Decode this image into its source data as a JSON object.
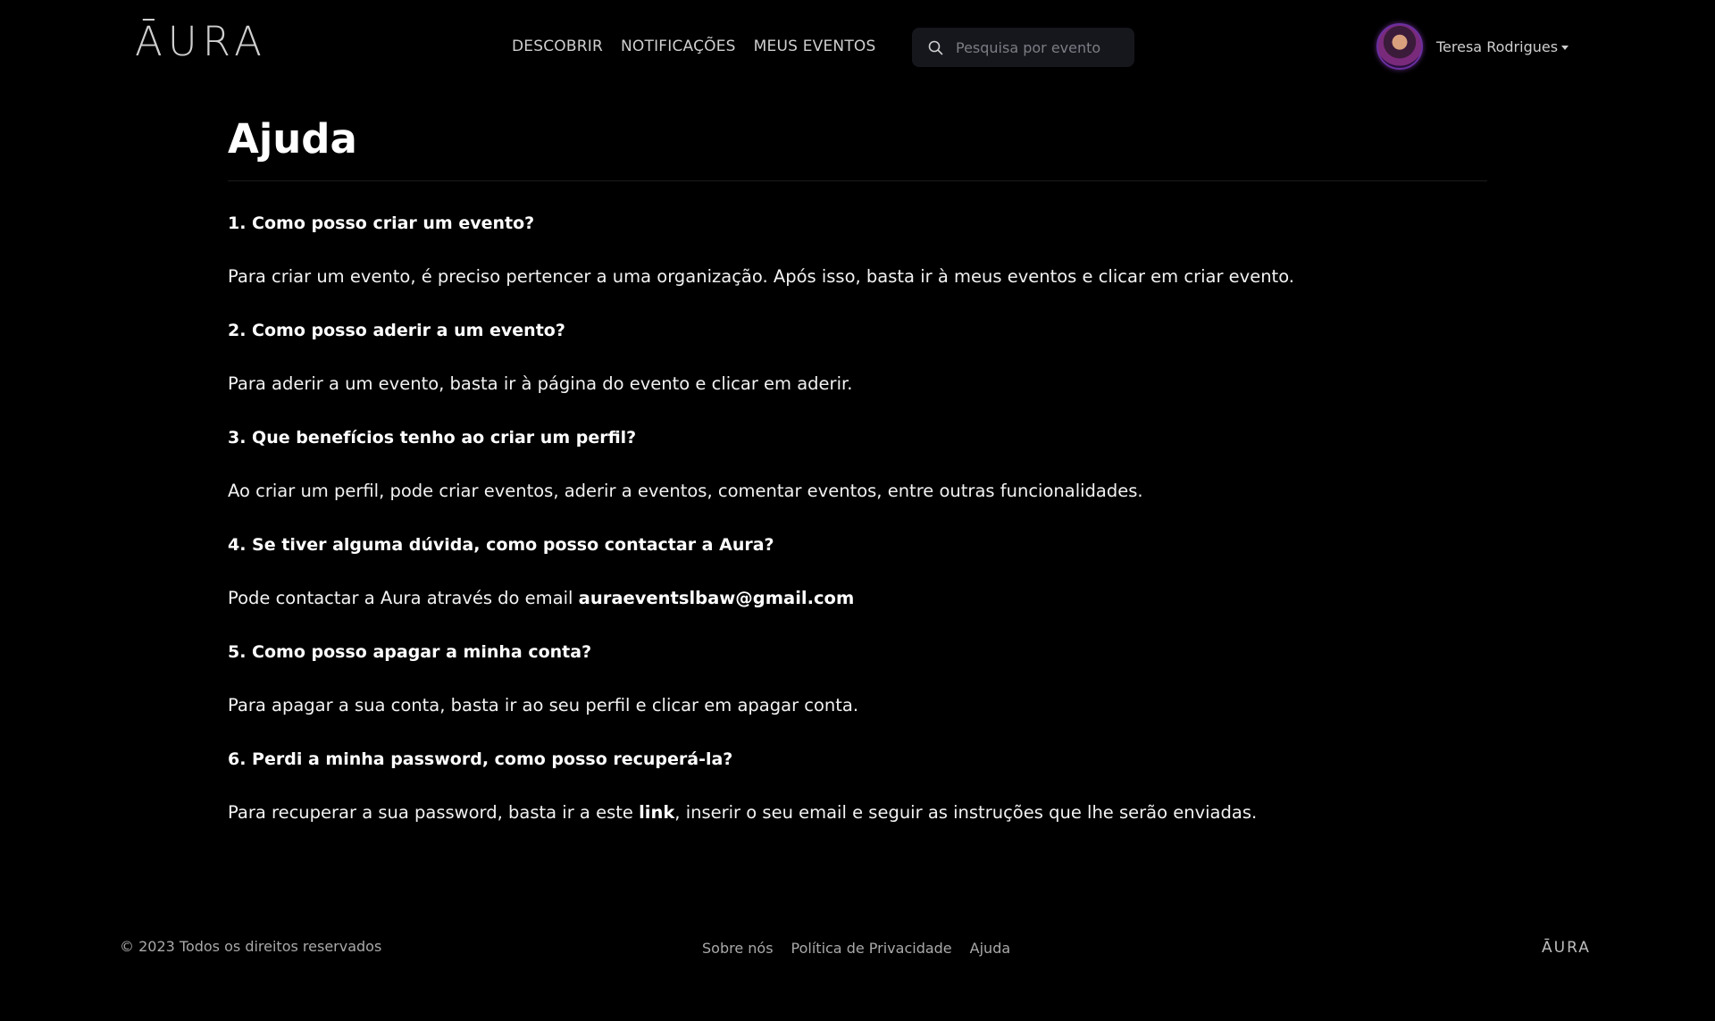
{
  "header": {
    "logo_text": "ĀURA",
    "nav": [
      {
        "label": "DESCOBRIR"
      },
      {
        "label": "NOTIFICAÇÕES"
      },
      {
        "label": "MEUS EVENTOS"
      }
    ],
    "search": {
      "placeholder": "Pesquisa por evento",
      "value": ""
    },
    "user": {
      "name": "Teresa Rodrigues"
    }
  },
  "page": {
    "title": "Ajuda"
  },
  "faq": [
    {
      "question": "1. Como posso criar um evento?",
      "answer": "Para criar um evento, é preciso pertencer a uma organização. Após isso, basta ir à meus eventos e clicar em criar evento."
    },
    {
      "question": "2. Como posso aderir a um evento?",
      "answer": "Para aderir a um evento, basta ir à página do evento e clicar em aderir."
    },
    {
      "question": "3. Que benefícios tenho ao criar um perfil?",
      "answer": "Ao criar um perfil, pode criar eventos, aderir a eventos, comentar eventos, entre outras funcionalidades."
    },
    {
      "question": "4. Se tiver alguma dúvida, como posso contactar a Aura?",
      "answer_prefix": "Pode contactar a Aura através do email ",
      "answer_email": "auraeventslbaw@gmail.com"
    },
    {
      "question": "5. Como posso apagar a minha conta?",
      "answer": "Para apagar a sua conta, basta ir ao seu perfil e clicar em apagar conta."
    },
    {
      "question": "6. Perdi a minha password, como posso recuperá-la?",
      "answer_prefix": "Para recuperar a sua password, basta ir a este ",
      "answer_link": "link",
      "answer_suffix": ", inserir o seu email e seguir as instruções que lhe serão enviadas."
    }
  ],
  "footer": {
    "copyright": "© 2023 Todos os direitos reservados",
    "links": [
      {
        "label": "Sobre nós"
      },
      {
        "label": "Política de Privacidade"
      },
      {
        "label": "Ajuda"
      }
    ],
    "logo_text": "ĀURA"
  },
  "colors": {
    "background": "#000000",
    "text": "#ffffff",
    "muted": "#a9a9a9",
    "search_bg": "#16171d"
  }
}
